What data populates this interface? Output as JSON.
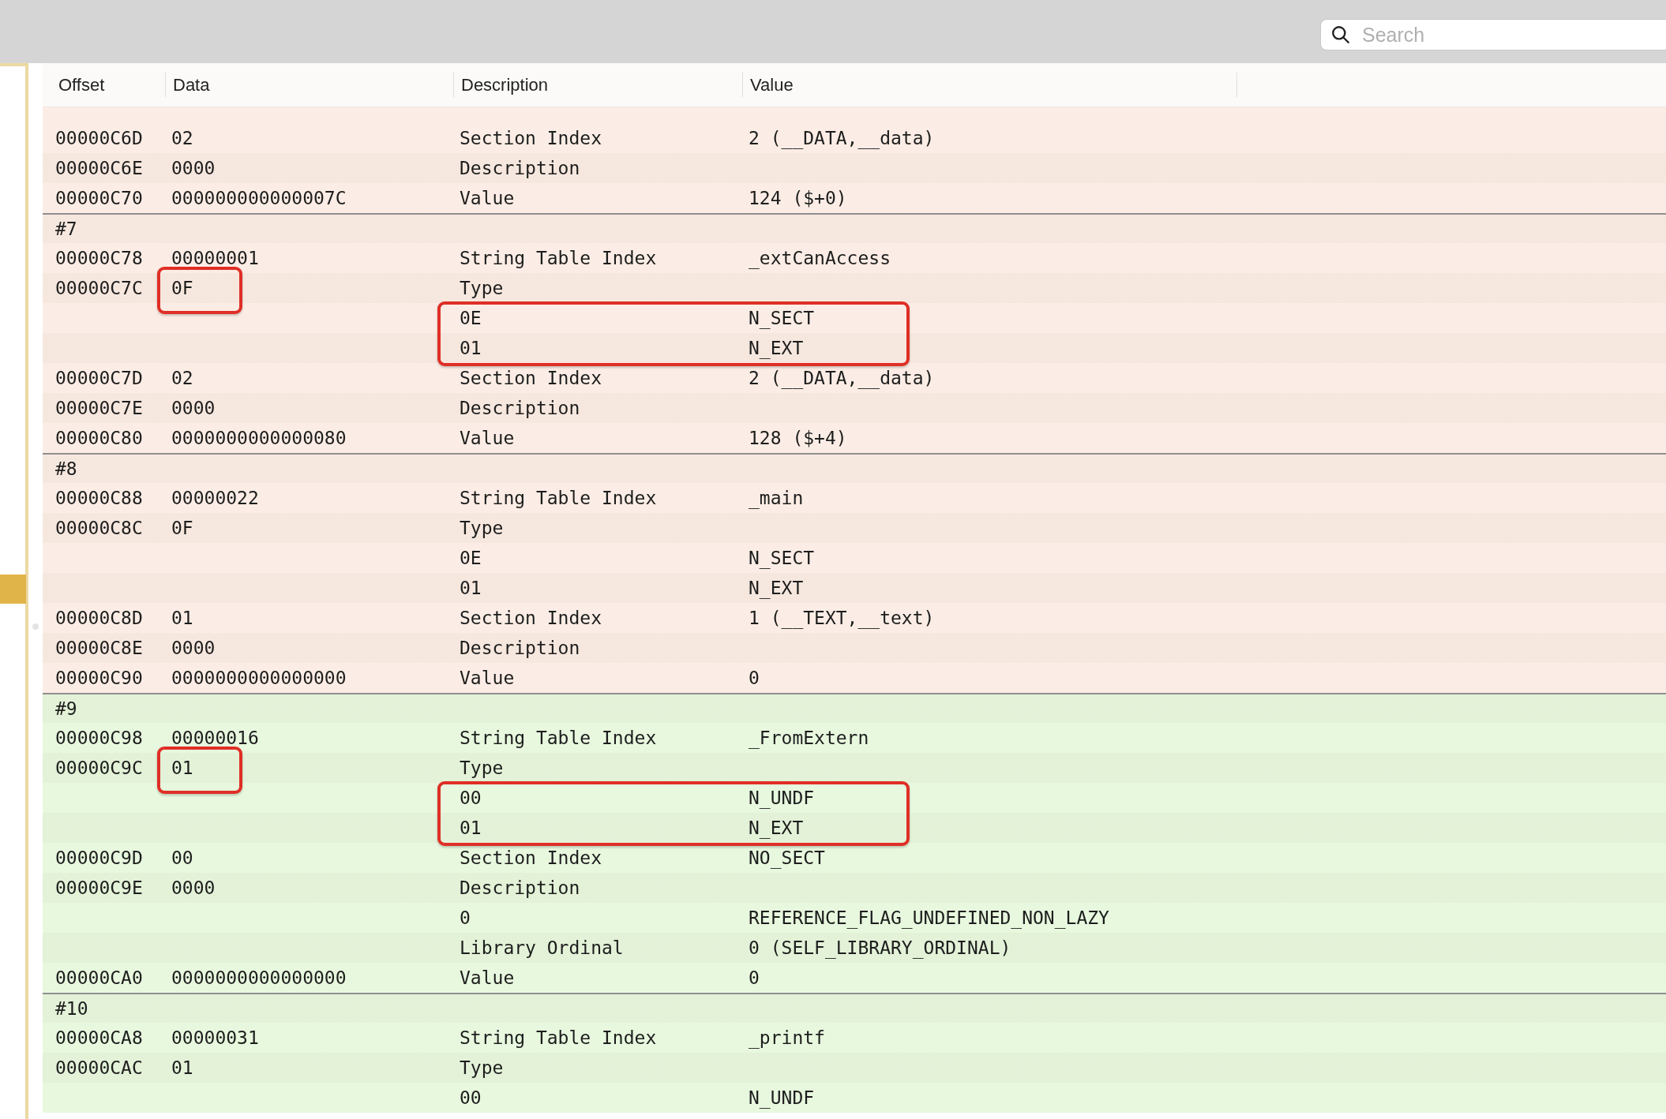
{
  "search": {
    "placeholder": "Search"
  },
  "columns": [
    "Offset",
    "Data",
    "Description",
    "Value"
  ],
  "symbols": [
    {
      "color": "#fbede5",
      "rows": [
        {
          "offset": "00000C6D",
          "data": "02",
          "description": "Section Index",
          "value": "2 (__DATA,__data)"
        },
        {
          "offset": "00000C6E",
          "data": "0000",
          "description": "Description"
        },
        {
          "offset": "00000C70",
          "data": "000000000000007C",
          "description": "Value",
          "value": "124 ($+0)"
        }
      ]
    },
    {
      "label": "#7",
      "color": "#fbede5",
      "rows": [
        {
          "offset": "00000C78",
          "data": "00000001",
          "description": "String Table Index",
          "value": "_extCanAccess"
        },
        {
          "offset": "00000C7C",
          "data": "0F",
          "description": "Type",
          "data_framed": true
        },
        {
          "description": "0E",
          "value": "N_SECT",
          "flags_framed": true
        },
        {
          "description": "01",
          "value": "N_EXT"
        },
        {
          "offset": "00000C7D",
          "data": "02",
          "description": "Section Index",
          "value": "2 (__DATA,__data)"
        },
        {
          "offset": "00000C7E",
          "data": "0000",
          "description": "Description"
        },
        {
          "offset": "00000C80",
          "data": "0000000000000080",
          "description": "Value",
          "value": "128 ($+4)"
        }
      ]
    },
    {
      "label": "#8",
      "color": "#fbede5",
      "rows": [
        {
          "offset": "00000C88",
          "data": "00000022",
          "description": "String Table Index",
          "value": "_main"
        },
        {
          "offset": "00000C8C",
          "data": "0F",
          "description": "Type"
        },
        {
          "description": "0E",
          "value": "N_SECT"
        },
        {
          "description": "01",
          "value": "N_EXT"
        },
        {
          "offset": "00000C8D",
          "data": "01",
          "description": "Section Index",
          "value": "1 (__TEXT,__text)"
        },
        {
          "offset": "00000C8E",
          "data": "0000",
          "description": "Description"
        },
        {
          "offset": "00000C90",
          "data": "0000000000000000",
          "description": "Value",
          "value": "0"
        }
      ]
    },
    {
      "label": "#9",
      "color": "#e7f8de",
      "rows": [
        {
          "offset": "00000C98",
          "data": "00000016",
          "description": "String Table Index",
          "value": "_FromExtern"
        },
        {
          "offset": "00000C9C",
          "data": "01",
          "description": "Type",
          "data_framed": true
        },
        {
          "description": "00",
          "value": "N_UNDF",
          "flags_framed": true
        },
        {
          "description": "01",
          "value": "N_EXT"
        },
        {
          "offset": "00000C9D",
          "data": "00",
          "description": "Section Index",
          "value": "NO_SECT"
        },
        {
          "offset": "00000C9E",
          "data": "0000",
          "description": "Description"
        },
        {
          "description": "0",
          "value": "REFERENCE_FLAG_UNDEFINED_NON_LAZY"
        },
        {
          "description": "Library Ordinal",
          "value": "0 (SELF_LIBRARY_ORDINAL)"
        },
        {
          "offset": "00000CA0",
          "data": "0000000000000000",
          "description": "Value",
          "value": "0"
        }
      ]
    },
    {
      "label": "#10",
      "color": "#e7f8de",
      "rows": [
        {
          "offset": "00000CA8",
          "data": "00000031",
          "description": "String Table Index",
          "value": "_printf"
        },
        {
          "offset": "00000CAC",
          "data": "01",
          "description": "Type"
        },
        {
          "description": "00",
          "value": "N_UNDF"
        }
      ]
    }
  ]
}
